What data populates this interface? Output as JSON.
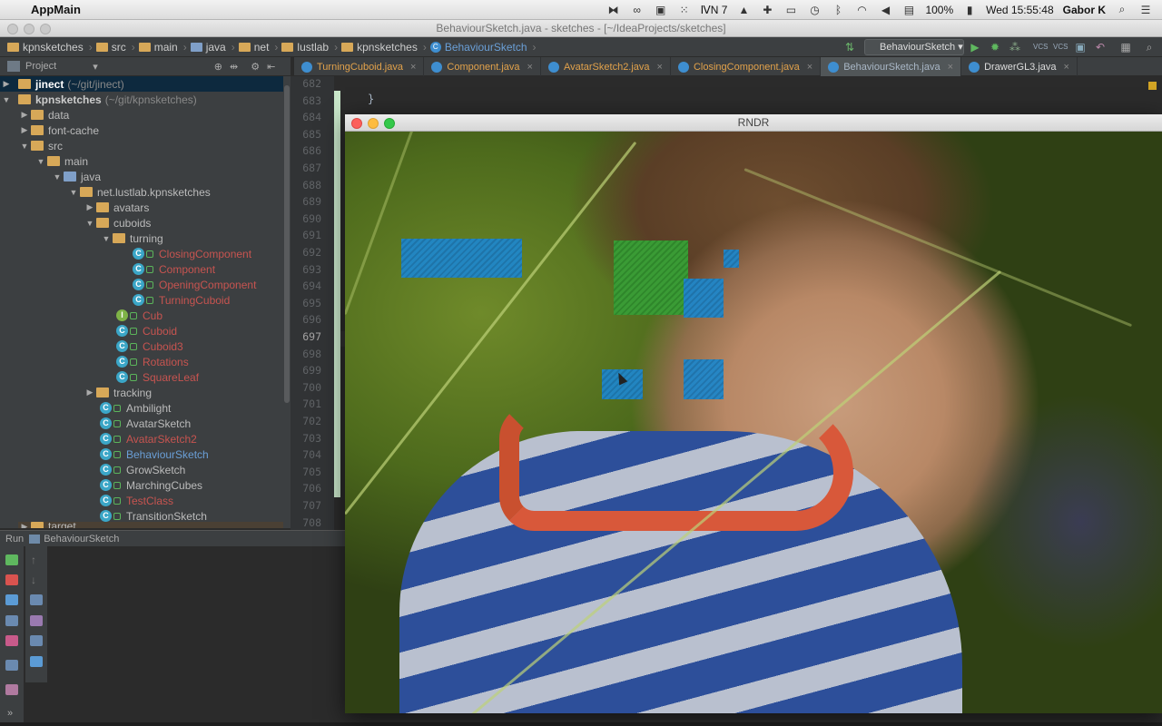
{
  "menubar": {
    "app_name": "AppMain",
    "battery": "100%",
    "clock": "Wed 15:55:48",
    "user": "Gabor K",
    "icons": [
      "apple-icon",
      "link-icon",
      "glasses-icon",
      "app-icon",
      "dots-icon",
      "adobe-icon",
      "drive-icon",
      "plus-icon",
      "display-icon",
      "clock-icon",
      "bluetooth-icon",
      "wifi-icon",
      "volume-icon",
      "flag-icon",
      "battery-icon",
      "search-icon",
      "list-icon"
    ],
    "adobe_count": "7"
  },
  "ide": {
    "window_title": "BehaviourSketch.java - sketches - [~/IdeaProjects/sketches]",
    "breadcrumbs": [
      "kpnsketches",
      "src",
      "main",
      "java",
      "net",
      "lustlab",
      "kpnsketches",
      "BehaviourSketch"
    ],
    "run_config": "BehaviourSketch",
    "project_label": "Project",
    "tabs": [
      {
        "label": "TurningCuboid.java"
      },
      {
        "label": "Component.java"
      },
      {
        "label": "AvatarSketch2.java"
      },
      {
        "label": "ClosingComponent.java"
      },
      {
        "label": "BehaviourSketch.java",
        "active": true
      },
      {
        "label": "DrawerGL3.java"
      }
    ]
  },
  "tree": {
    "root1": {
      "label": "jinect",
      "path": "(~/git/jinect)"
    },
    "root2": {
      "label": "kpnsketches",
      "path": "(~/git/kpnsketches)"
    },
    "items": [
      {
        "label": "data"
      },
      {
        "label": "font-cache"
      },
      {
        "label": "src"
      },
      {
        "label": "main"
      },
      {
        "label": "java"
      },
      {
        "label": "net.lustlab.kpnsketches"
      },
      {
        "label": "avatars"
      },
      {
        "label": "cuboids"
      },
      {
        "label": "turning"
      },
      {
        "label": "ClosingComponent"
      },
      {
        "label": "Component"
      },
      {
        "label": "OpeningComponent"
      },
      {
        "label": "TurningCuboid"
      },
      {
        "label": "Cub"
      },
      {
        "label": "Cuboid"
      },
      {
        "label": "Cuboid3"
      },
      {
        "label": "Rotations"
      },
      {
        "label": "SquareLeaf"
      },
      {
        "label": "tracking"
      },
      {
        "label": "Ambilight"
      },
      {
        "label": "AvatarSketch"
      },
      {
        "label": "AvatarSketch2"
      },
      {
        "label": "BehaviourSketch"
      },
      {
        "label": "GrowSketch"
      },
      {
        "label": "MarchingCubes"
      },
      {
        "label": "TestClass"
      },
      {
        "label": "TransitionSketch"
      },
      {
        "label": "target"
      }
    ]
  },
  "editor": {
    "line_numbers": [
      "682",
      "683",
      "684",
      "685",
      "686",
      "687",
      "688",
      "689",
      "690",
      "691",
      "692",
      "693",
      "694",
      "695",
      "696",
      "697",
      "698",
      "699",
      "700",
      "701",
      "702",
      "703",
      "704",
      "705",
      "706",
      "707",
      "708"
    ],
    "code_line": "}"
  },
  "run": {
    "label": "Run",
    "config": "BehaviourSketch"
  },
  "rndr": {
    "title": "RNDR"
  },
  "colors": {
    "ide_bg": "#2b2b2b",
    "panel_bg": "#3c3f41",
    "modified_file": "#c75450",
    "blue_rect": "#1f86c9",
    "green_rect": "#3a9b35"
  }
}
